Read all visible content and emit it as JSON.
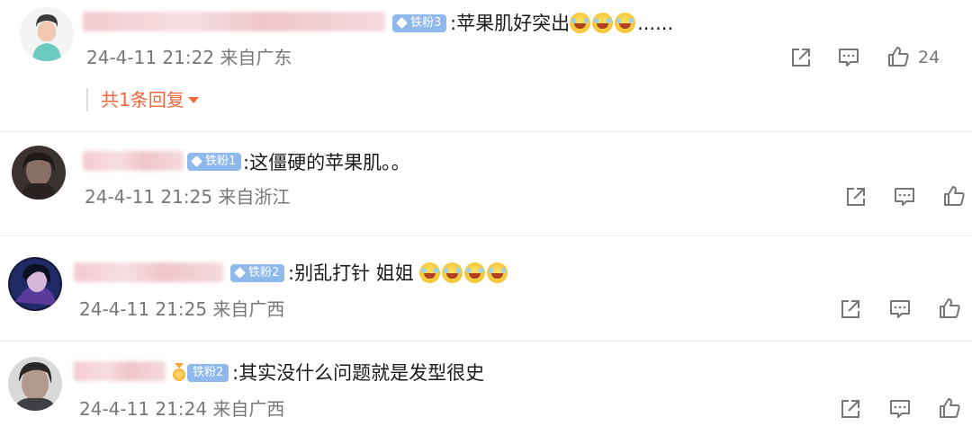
{
  "comments": [
    {
      "badge": "铁粉3",
      "text": ":苹果肌好突出",
      "emoji_count": 3,
      "trailing": "......",
      "meta": "24-4-11 21:22 来自广东",
      "likes": "24",
      "replies_label": "共1条回复"
    },
    {
      "badge": "铁粉1",
      "text": ":这僵硬的苹果肌。。",
      "emoji_count": 0,
      "trailing": "",
      "meta": "24-4-11 21:25 来自浙江",
      "likes": ""
    },
    {
      "badge": "铁粉2",
      "text": ":别乱打针 姐姐",
      "emoji_count": 4,
      "trailing": "",
      "meta": "24-4-11 21:25 来自广西",
      "likes": ""
    },
    {
      "badge": "铁粉2",
      "text": ":其实没什么问题就是发型很史",
      "emoji_count": 0,
      "trailing": "",
      "meta": "24-4-11 21:24 来自广西",
      "likes": ""
    }
  ],
  "icons": {
    "share": "share-icon",
    "comment": "comment-icon",
    "like": "thumbs-up-icon",
    "badge": "diamond-icon",
    "emoji": "laugh-cry-emoji"
  },
  "colors": {
    "badge_bg": "#8fb8ec",
    "reply_link": "#f2663c",
    "meta_text": "#777777"
  }
}
